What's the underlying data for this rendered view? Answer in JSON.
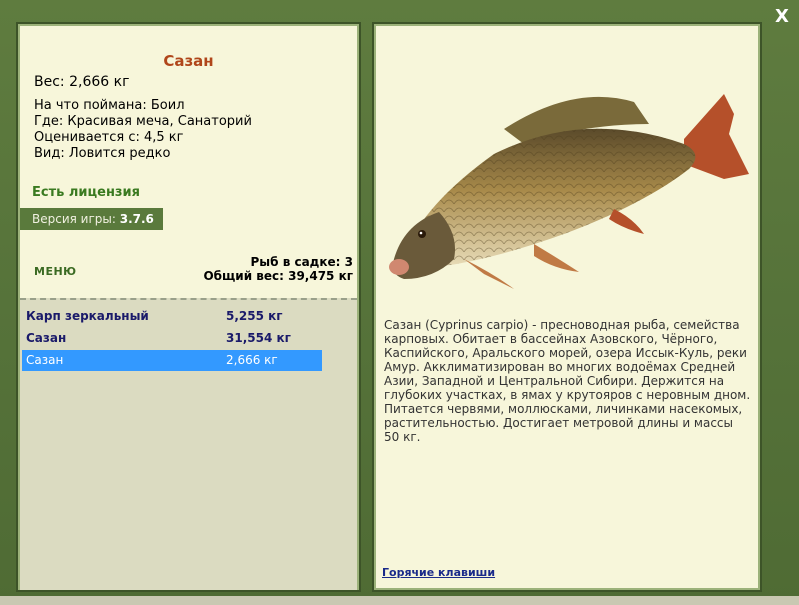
{
  "window": {
    "close_label": "X"
  },
  "fish": {
    "name": "Сазан",
    "weight": "Вес: 2,666 кг",
    "caught_with": "На что поймана: Боил",
    "location": "Где: Красивая меча, Санаторий",
    "valued_from": "Оценивается с: 4,5 кг",
    "kind": "Вид: Ловится редко"
  },
  "license": {
    "text": "Есть лицензия"
  },
  "version": {
    "label": "Версия игры:",
    "value": "3.7.6"
  },
  "menu": {
    "label": "МЕНЮ"
  },
  "keepnet": {
    "count_text": "Рыб в садке: 3",
    "total_weight_text": "Общий вес: 39,475 кг",
    "items": [
      {
        "name": "Карп зеркальный",
        "weight": "5,255 кг"
      },
      {
        "name": "Сазан",
        "weight": "31,554 кг"
      },
      {
        "name": "Сазан",
        "weight": "2,666 кг"
      }
    ]
  },
  "description": "Сазан (Cyprinus carpio) - пресноводная рыба, семейства карповых. Обитает в бассейнах Азовского, Чёрного, Каспийского, Аральского морей, озера Иссык-Куль, реки Амур. Акклиматизирован во многих водоёмах Средней Азии, Западной и Центральной Сибири. Держится на глубоких участках, в ямах у крутояров с неровным дном. Питается червями, моллюсками, личинками насекомых, растительностью. Достигает метровой длины и массы 50 кг.",
  "hotkeys": {
    "label": "Горячие клавиши"
  },
  "colors": {
    "frame": "#5e7a3e",
    "panel": "#f7f6da",
    "selected": "#3399ff",
    "title": "#b0461a"
  },
  "icons": {
    "close": "close-icon",
    "fish": "fish-illustration"
  }
}
